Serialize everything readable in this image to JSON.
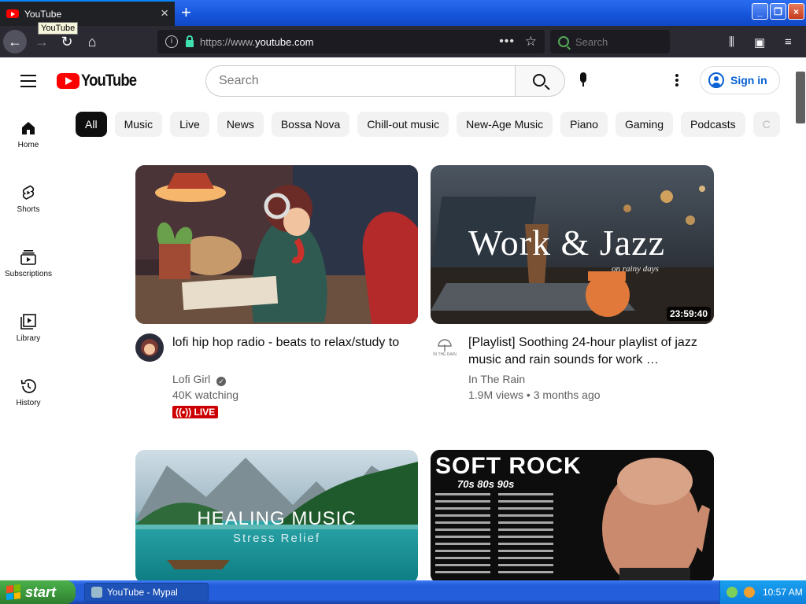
{
  "browser": {
    "tab_title": "YouTube",
    "tooltip": "YouTube",
    "url_prefix": "https://www.",
    "url_domain": "youtube.com",
    "search_placeholder": "Search"
  },
  "header": {
    "logo_text": "YouTube",
    "search_placeholder": "Search",
    "signin_label": "Sign in"
  },
  "chips": [
    "All",
    "Music",
    "Live",
    "News",
    "Bossa Nova",
    "Chill-out music",
    "New-Age Music",
    "Piano",
    "Gaming",
    "Podcasts",
    "C"
  ],
  "sidebar": {
    "items": [
      {
        "label": "Home"
      },
      {
        "label": "Shorts"
      },
      {
        "label": "Subscriptions"
      },
      {
        "label": "Library"
      },
      {
        "label": "History"
      }
    ]
  },
  "videos": [
    {
      "title": "lofi hip hop radio - beats to relax/study to",
      "channel": "Lofi Girl",
      "verified": true,
      "meta": "40K watching",
      "badge": "LIVE"
    },
    {
      "title": "[Playlist] Soothing 24-hour playlist of jazz music and rain sounds for work …",
      "channel": "In The Rain",
      "meta": "1.9M views • 3 months ago",
      "duration": "23:59:40",
      "thumb_text": "Work & Jazz",
      "thumb_subtext": "on rainy days",
      "avatar_text": "IN THE RAIN"
    },
    {
      "thumb_text": "HEALING MUSIC",
      "thumb_subtext": "Stress Relief"
    },
    {
      "thumb_text": "SOFT ROCK",
      "thumb_subtext": "70s 80s 90s"
    }
  ],
  "taskbar": {
    "start_label": "start",
    "window_label": "YouTube - Mypal",
    "clock": "10:57 AM"
  },
  "colors": {
    "yt_red": "#ff0000",
    "link_blue": "#065fd4",
    "live_red": "#cc0000",
    "chip_bg": "#f2f2f2"
  }
}
